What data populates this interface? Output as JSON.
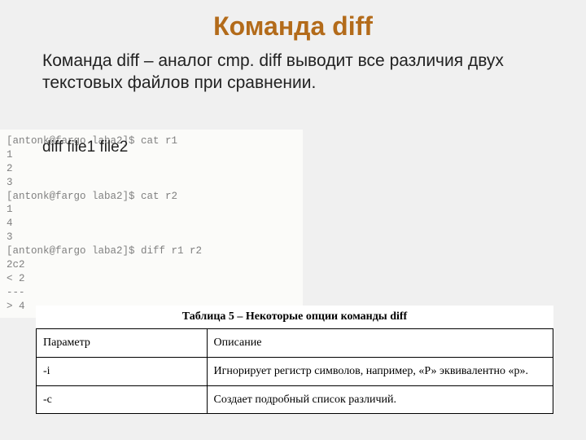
{
  "title": "Команда diff",
  "description": "Команда diff – аналог cmp. diff выводит все различия двух текстовых файлов при сравнении.",
  "usage": "diff file1 file2",
  "terminal": {
    "line1": "[antonk@fargo laba2]$ cat r1",
    "line2": "1",
    "line3": "2",
    "line4": "3",
    "line5": "[antonk@fargo laba2]$ cat r2",
    "line6": "1",
    "line7": "4",
    "line8": "3",
    "line9": "[antonk@fargo laba2]$ diff r1 r2",
    "line10": "2c2",
    "line11": "< 2",
    "line12": "---",
    "line13": "> 4"
  },
  "table": {
    "caption": "Таблица 5 – Некоторые опции команды diff",
    "header_param": "Параметр",
    "header_desc": "Описание",
    "rows": [
      {
        "param": "-i",
        "desc": "Игнорирует регистр символов, например, «Р» эквивалентно «р»."
      },
      {
        "param": "-c",
        "desc": "Создает подробный список различий."
      }
    ]
  }
}
